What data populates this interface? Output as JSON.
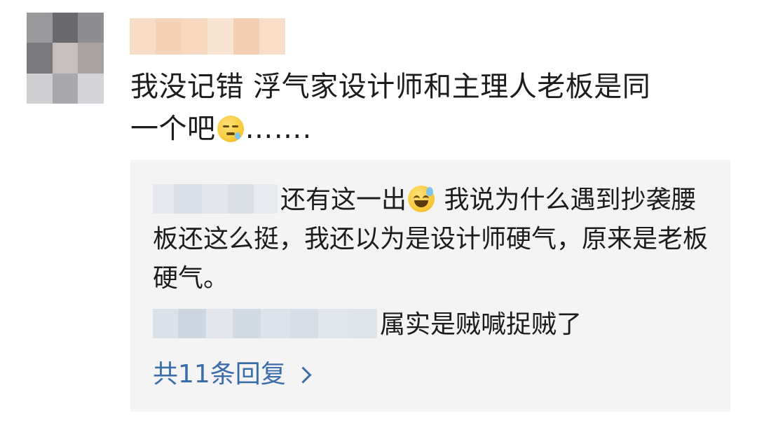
{
  "comment": {
    "text_line1": "我没记错 浮气家设计师和主理人老板是同",
    "text_line2": "一个吧",
    "text_after_emoji": "……."
  },
  "replies": [
    {
      "text_before_emoji": "还有这一出",
      "text_after_emoji": " 我说为什么遇到抄袭腰板还这么挺，我还以为是设计师硬气，原来是老板硬气。"
    },
    {
      "text": "属实是贼喊捉贼了"
    }
  ],
  "more_replies": {
    "label": "共11条回复"
  },
  "icons": {
    "comment_emoji": "sleepy-sweat-emoji-icon",
    "reply_emoji": "grinning-sweat-emoji-icon",
    "more_replies": "chevron-right-icon"
  },
  "colors": {
    "link": "#3b6ea8",
    "reply_bg": "#f4f4f5",
    "text": "#1c1c1c"
  }
}
